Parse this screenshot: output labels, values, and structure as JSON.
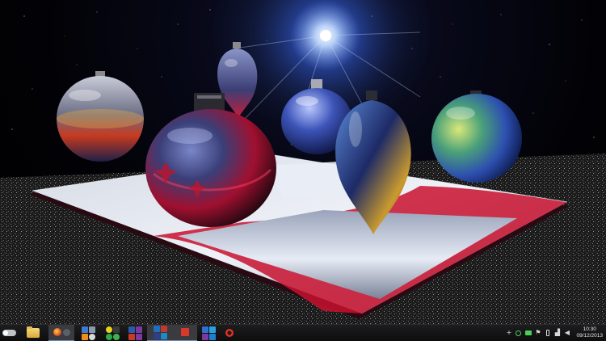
{
  "wallpaper": {
    "description_icon": "christmas-ornaments-wallpaper",
    "colors": {
      "light_flare": "#9fc6ff",
      "ornament_red": "#c8102e",
      "ornament_blue": "#1b3c9a",
      "gold": "#c9a23a",
      "ribbon_red": "#e0102a"
    }
  },
  "taskbar": {
    "start_icon": "start-toggle-icon",
    "pinned": [
      {
        "name": "file-explorer-button",
        "icon": "folder-icon"
      },
      {
        "name": "firefox-button",
        "icon": "firefox-icon",
        "active": true
      },
      {
        "name": "tools-group-button",
        "icon": "tools-group-icon"
      },
      {
        "name": "office-group-button",
        "icon": "office-group-icon"
      },
      {
        "name": "adobe-group-button",
        "icon": "adobe-group-icon",
        "active": true
      },
      {
        "name": "dell-button",
        "icon": "dell-icon"
      },
      {
        "name": "mail-group-button",
        "icon": "mail-group-icon"
      },
      {
        "name": "pocket-button",
        "icon": "pocket-icon"
      }
    ],
    "accent_color": "#6b8fc4"
  },
  "tray": {
    "icons": [
      "show-hidden-icon",
      "network-sync-icon",
      "display-icon",
      "action-center-flag-icon",
      "battery-icon",
      "signal-icon",
      "volume-icon"
    ],
    "time": "10:30",
    "date": "09/12/2013"
  }
}
